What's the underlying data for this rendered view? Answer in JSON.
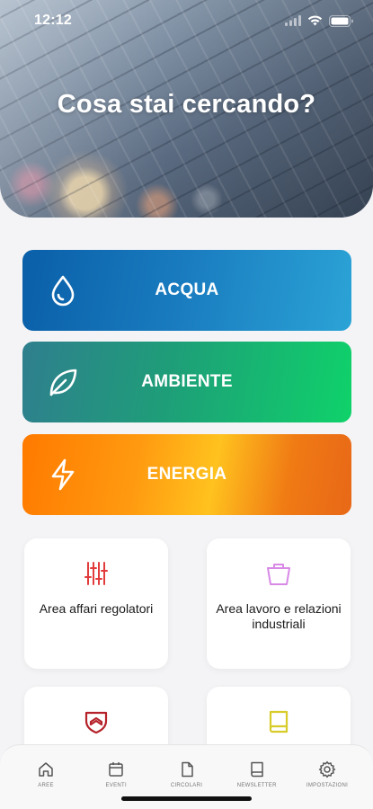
{
  "status_bar": {
    "time": "12:12"
  },
  "hero": {
    "title": "Cosa stai cercando?"
  },
  "categories": [
    {
      "label": "ACQUA",
      "icon": "water-drop-icon"
    },
    {
      "label": "AMBIENTE",
      "icon": "leaf-icon"
    },
    {
      "label": "ENERGIA",
      "icon": "lightning-icon"
    }
  ],
  "areas": [
    {
      "label": "Area affari regolatori",
      "icon": "sliders-icon",
      "color": "#e23b3b"
    },
    {
      "label": "Area lavoro e relazioni industriali",
      "icon": "basket-icon",
      "color": "#d889e6"
    },
    {
      "label": "",
      "icon": "shield-icon",
      "color": "#b5222a"
    },
    {
      "label": "",
      "icon": "book-icon",
      "color": "#d8cc2a"
    }
  ],
  "tabbar": {
    "items": [
      {
        "label": "AREE",
        "icon": "home-icon"
      },
      {
        "label": "EVENTI",
        "icon": "calendar-icon"
      },
      {
        "label": "CIRCOLARI",
        "icon": "document-icon"
      },
      {
        "label": "NEWSLETTER",
        "icon": "book-icon"
      },
      {
        "label": "IMPOSTAZIONI",
        "icon": "gear-icon"
      }
    ]
  }
}
